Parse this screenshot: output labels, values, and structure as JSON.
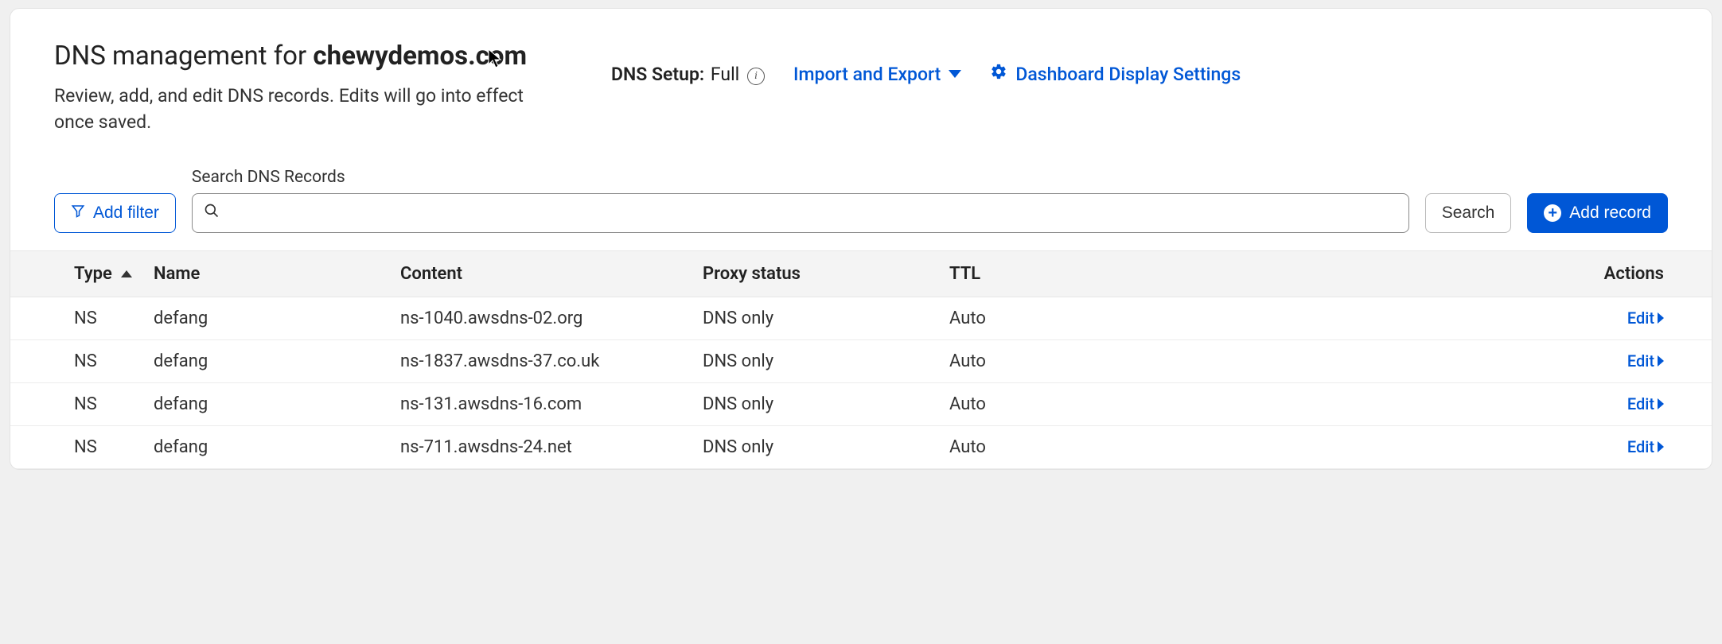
{
  "header": {
    "title_prefix": "DNS management for ",
    "domain": "chewydemos.com",
    "subtitle": "Review, add, and edit DNS records. Edits will go into effect once saved.",
    "dns_setup_label": "DNS Setup:",
    "dns_setup_value": "Full",
    "import_export_label": "Import and Export",
    "display_settings_label": "Dashboard Display Settings"
  },
  "controls": {
    "add_filter_label": "Add filter",
    "search_label": "Search DNS Records",
    "search_value": "",
    "search_placeholder": "",
    "search_button_label": "Search",
    "add_record_label": "Add record"
  },
  "table": {
    "columns": {
      "type": "Type",
      "name": "Name",
      "content": "Content",
      "proxy": "Proxy status",
      "ttl": "TTL",
      "actions": "Actions"
    },
    "edit_label": "Edit",
    "rows": [
      {
        "type": "NS",
        "name": "defang",
        "content": "ns-1040.awsdns-02.org",
        "proxy": "DNS only",
        "ttl": "Auto"
      },
      {
        "type": "NS",
        "name": "defang",
        "content": "ns-1837.awsdns-37.co.uk",
        "proxy": "DNS only",
        "ttl": "Auto"
      },
      {
        "type": "NS",
        "name": "defang",
        "content": "ns-131.awsdns-16.com",
        "proxy": "DNS only",
        "ttl": "Auto"
      },
      {
        "type": "NS",
        "name": "defang",
        "content": "ns-711.awsdns-24.net",
        "proxy": "DNS only",
        "ttl": "Auto"
      }
    ]
  }
}
